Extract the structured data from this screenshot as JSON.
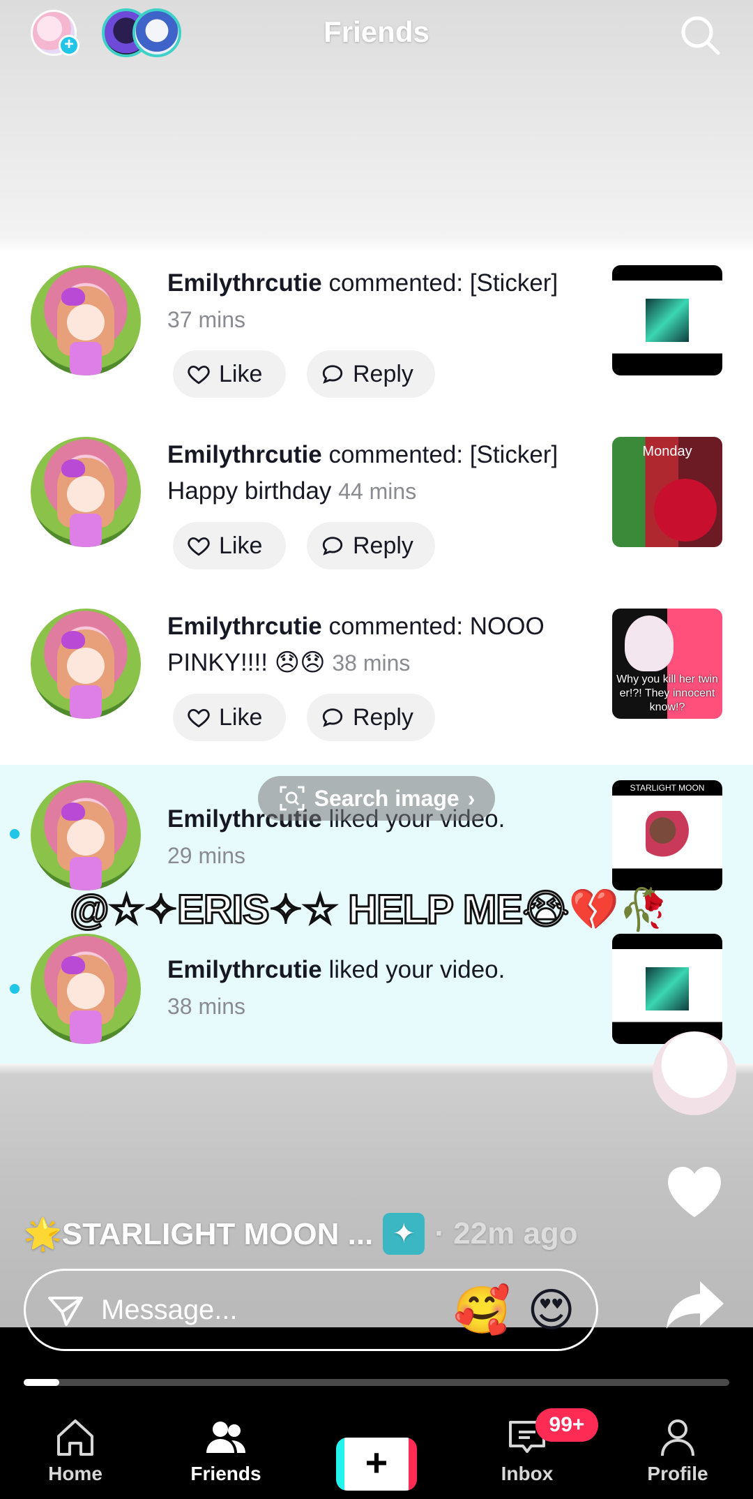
{
  "header": {
    "title": "Friends"
  },
  "notifications": [
    {
      "username": "Emilythrcutie",
      "action": " commented: [Sticker]",
      "body": "",
      "time": "37 mins",
      "like_label": "Like",
      "reply_label": "Reply",
      "unread": false
    },
    {
      "username": "Emilythrcutie",
      "action": " commented: [Sticker]",
      "body": "Happy birthday",
      "time": "44 mins",
      "like_label": "Like",
      "reply_label": "Reply",
      "unread": false
    },
    {
      "username": "Emilythrcutie",
      "action": " commented: NOOO PINKY!!!! 😞😞",
      "body": "",
      "time": "38 mins",
      "like_label": "Like",
      "reply_label": "Reply",
      "unread": false,
      "thumb_caption": "Why you kill her twin er!?! They innocent know!?"
    },
    {
      "username": "Emilythrcutie",
      "action": " liked your video.",
      "time": "29 mins",
      "unread": true,
      "thumb_label": "STARLIGHT MOON"
    },
    {
      "username": "Emilythrcutie",
      "action": " liked your video.",
      "time": "38 mins",
      "unread": true
    }
  ],
  "thumb2_label": "Monday",
  "search_image_label": "Search image",
  "caption_overlay": "@☆✧ERIS✧☆ HELP ME😭💔🥀",
  "video": {
    "author": "🌟STARLIGHT MOON ...",
    "badge_icon": "sparkle-icon",
    "time": "· 22m ago",
    "progress": 0.05
  },
  "message": {
    "placeholder": "Message...",
    "emoji_1": "🥰",
    "emoji_2": "😍"
  },
  "nav": {
    "home": "Home",
    "friends": "Friends",
    "inbox": "Inbox",
    "inbox_badge": "99+",
    "profile": "Profile"
  },
  "colors": {
    "accent_cyan": "#20c5e8",
    "badge_red": "#fe2c55",
    "unread_bg": "#e8fbfc"
  }
}
